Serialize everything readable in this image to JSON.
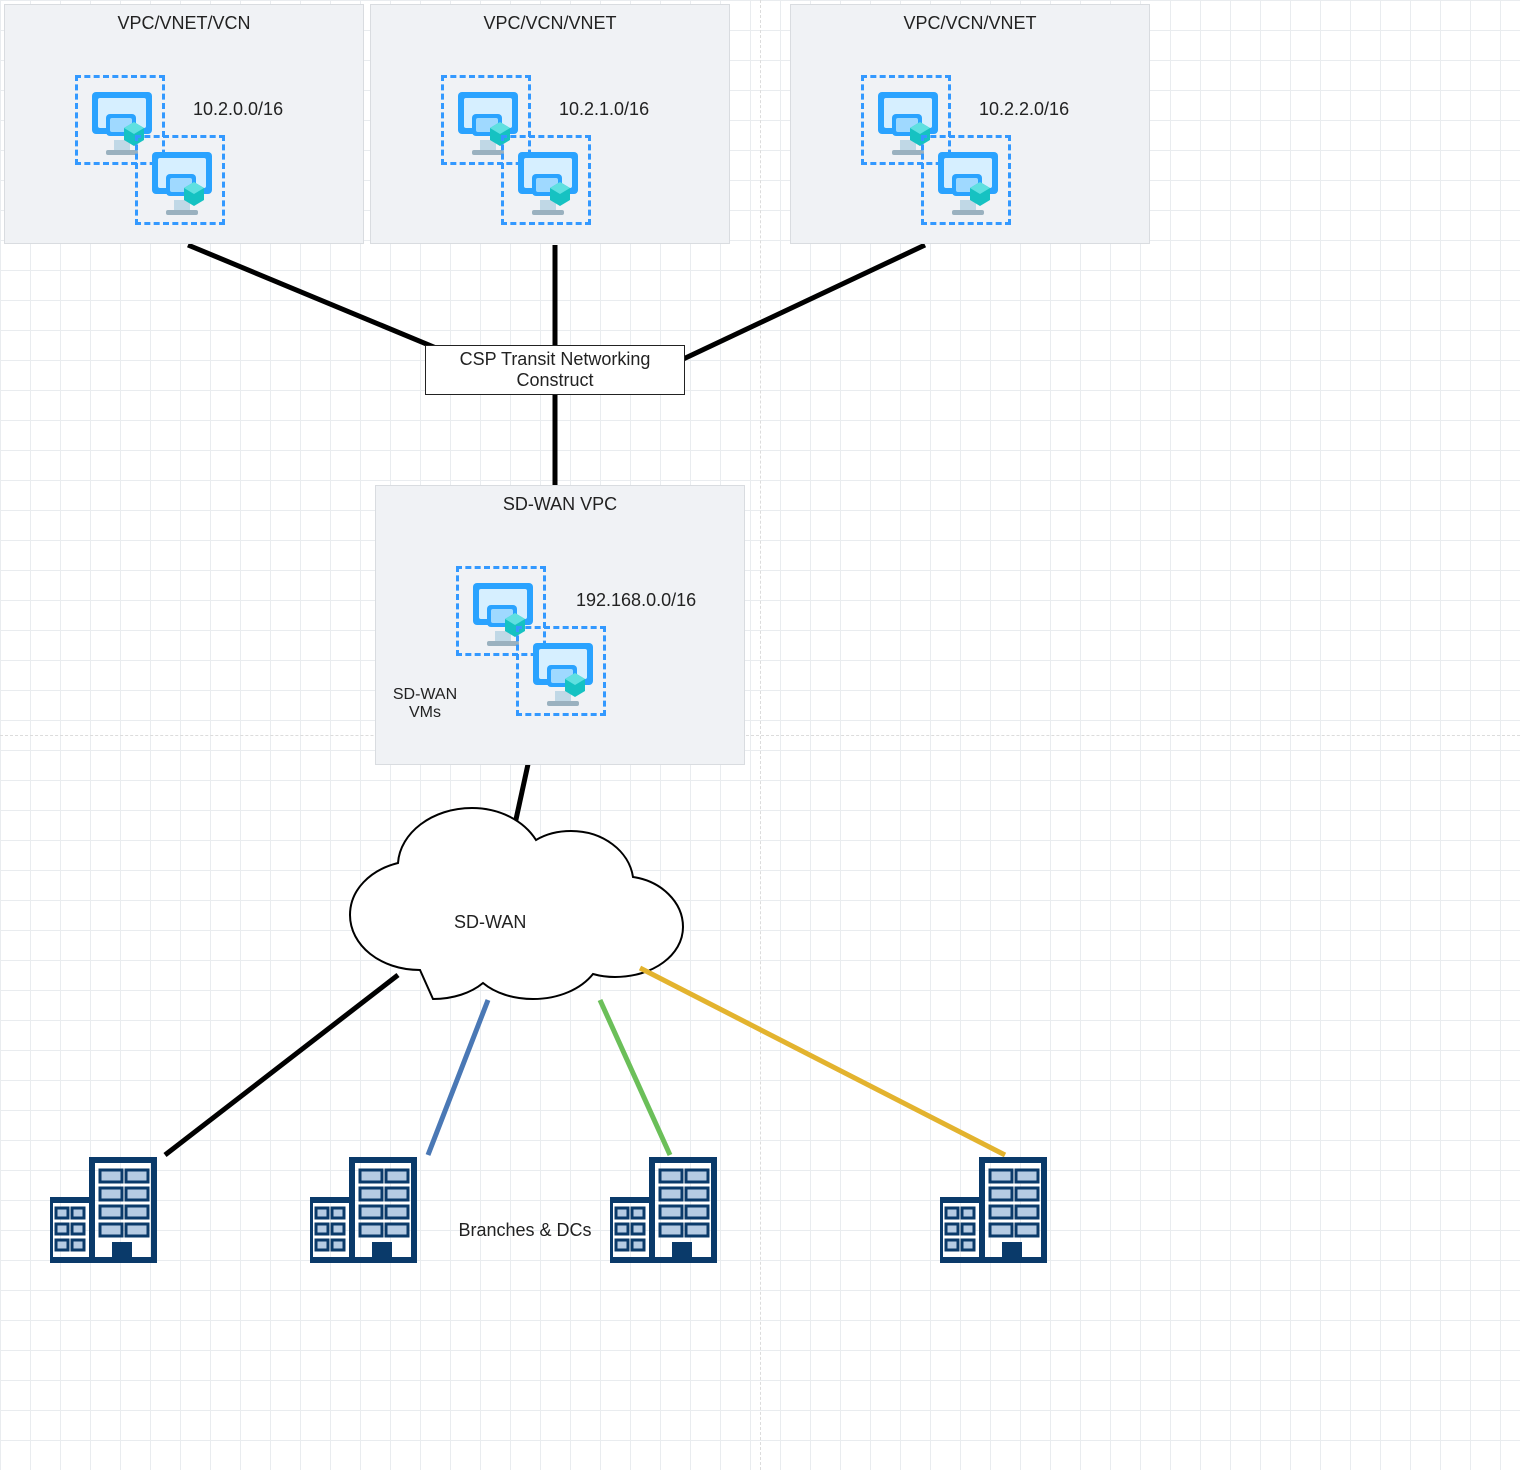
{
  "vpcs": [
    {
      "title": "VPC/VNET/VCN",
      "cidr": "10.2.0.0/16"
    },
    {
      "title": "VPC/VCN/VNET",
      "cidr": "10.2.1.0/16"
    },
    {
      "title": "VPC/VCN/VNET",
      "cidr": "10.2.2.0/16"
    }
  ],
  "transit_label": "CSP Transit Networking Construct",
  "sdwan_vpc": {
    "title": "SD-WAN VPC",
    "cidr": "192.168.0.0/16",
    "vm_label": "SD-WAN\nVMs"
  },
  "cloud_label": "SD-WAN",
  "bottom_label": "Branches & DCs",
  "colors": {
    "link_default": "#000000",
    "link_blue": "#4a78b5",
    "link_green": "#6bbf59",
    "link_yellow": "#e3b32e"
  }
}
